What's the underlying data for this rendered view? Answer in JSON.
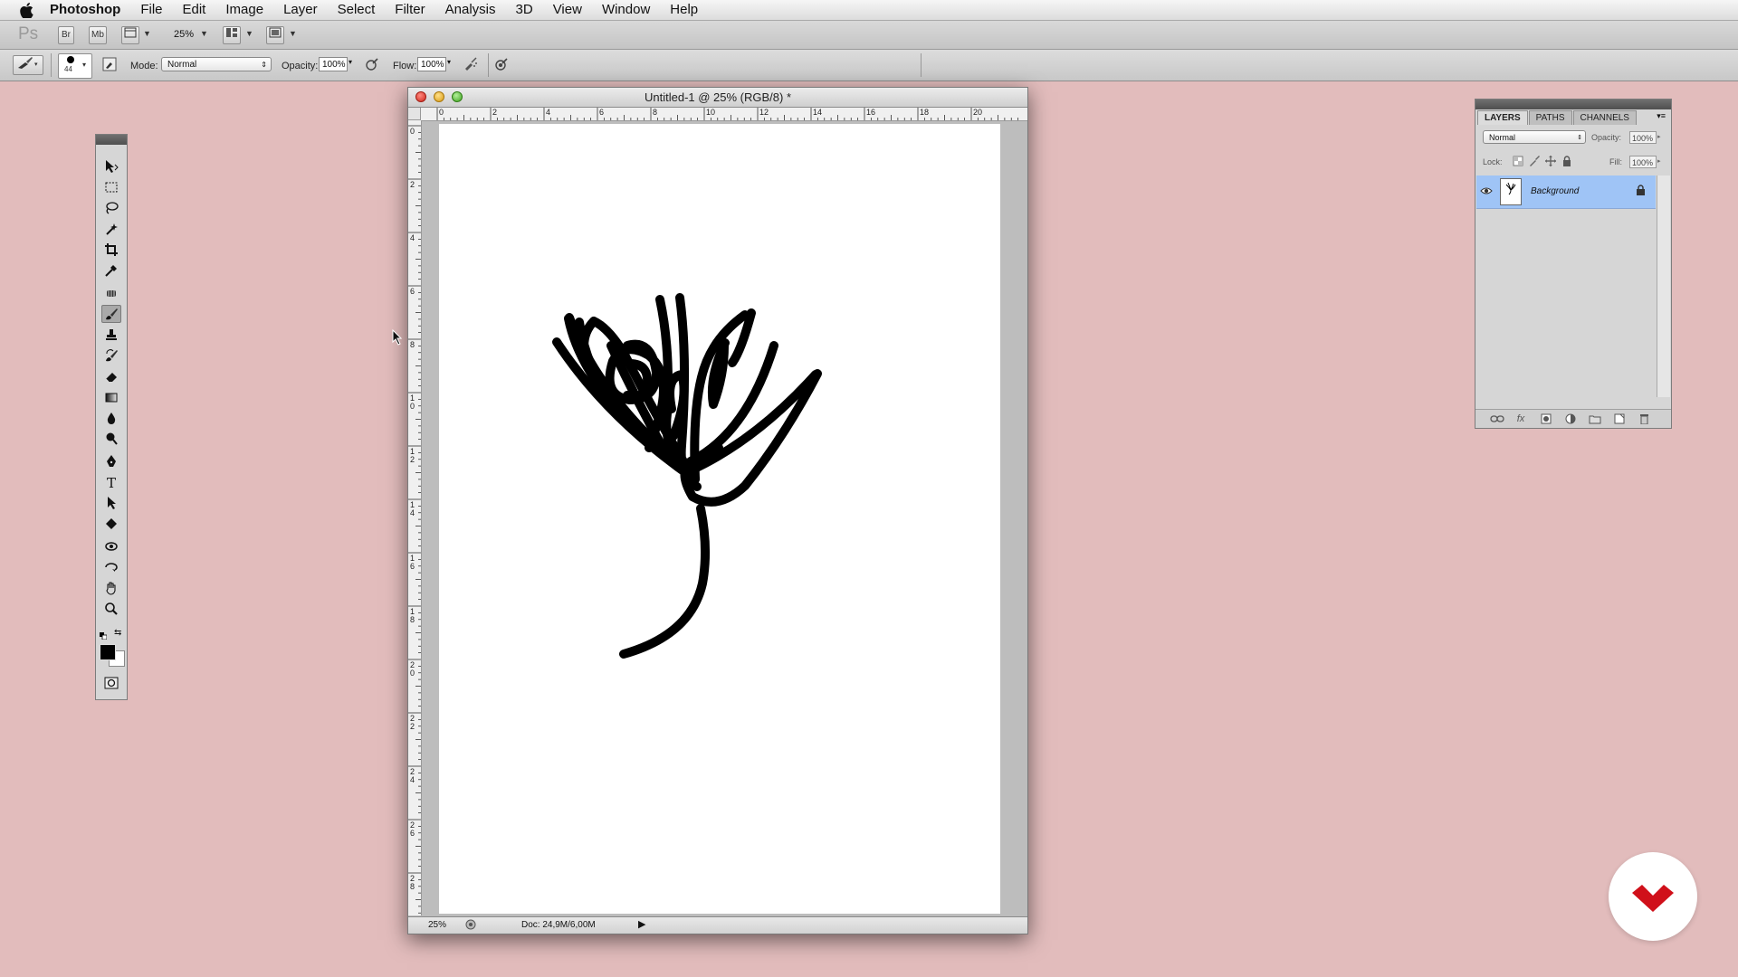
{
  "menubar": {
    "app_name": "Photoshop",
    "items": [
      "File",
      "Edit",
      "Image",
      "Layer",
      "Select",
      "Filter",
      "Analysis",
      "3D",
      "View",
      "Window",
      "Help"
    ]
  },
  "appbar": {
    "logo": "Ps",
    "bridge_label": "Br",
    "minibridge_label": "Mb",
    "zoom": "25%"
  },
  "options": {
    "brush_size": "44",
    "mode_label": "Mode:",
    "mode_value": "Normal",
    "opacity_label": "Opacity:",
    "opacity_value": "100%",
    "flow_label": "Flow:",
    "flow_value": "100%"
  },
  "document": {
    "title": "Untitled-1 @ 25% (RGB/8) *",
    "status_zoom": "25%",
    "status_doc": "Doc: 24,9M/6,00M",
    "ruler_h_labels": [
      "0",
      "2",
      "4",
      "6",
      "8",
      "10",
      "12",
      "14",
      "16",
      "18",
      "20"
    ],
    "ruler_v_labels": [
      "0",
      "2",
      "4",
      "6",
      "8",
      "10",
      "12",
      "14",
      "16",
      "18",
      "20",
      "22",
      "24",
      "26",
      "28"
    ]
  },
  "layers_panel": {
    "tabs": [
      "LAYERS",
      "PATHS",
      "CHANNELS"
    ],
    "blend_mode": "Normal",
    "opacity_label": "Opacity:",
    "opacity_value": "100%",
    "lock_label": "Lock:",
    "fill_label": "Fill:",
    "fill_value": "100%",
    "layers": [
      {
        "name": "Background",
        "locked": true,
        "visible": true
      }
    ]
  },
  "colors": {
    "desktop": "#e2bcbc",
    "selected_layer": "#9fc4f6",
    "brand": "#d0101a"
  }
}
